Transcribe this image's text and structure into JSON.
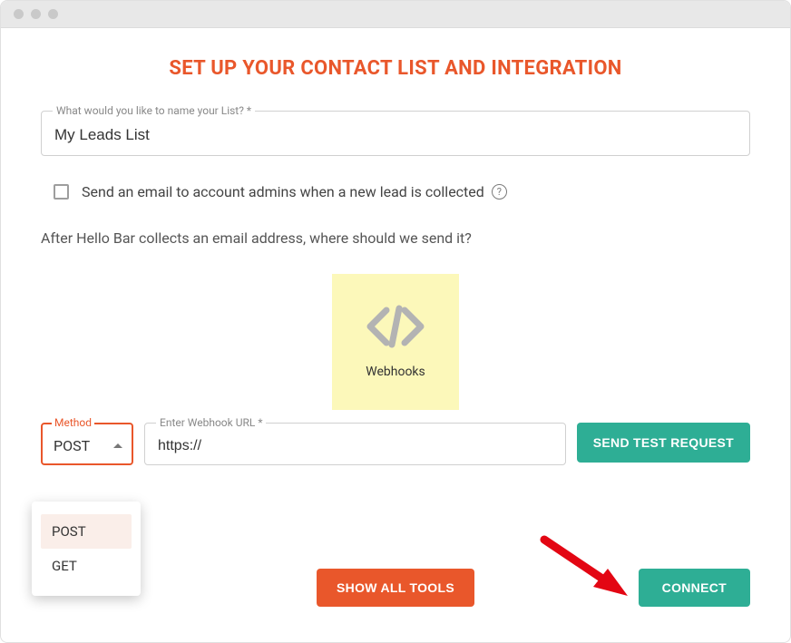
{
  "header": {
    "title": "SET UP YOUR CONTACT LIST AND INTEGRATION"
  },
  "list_name": {
    "label": "What would you like to name your List? *",
    "value": "My Leads List"
  },
  "admin_email": {
    "label": "Send an email to account admins when a new lead is collected",
    "checked": false
  },
  "prompt": "After Hello Bar collects an email address, where should we send it?",
  "integration_tile": {
    "label": "Webhooks"
  },
  "method": {
    "label": "Method",
    "value": "POST",
    "options": [
      "POST",
      "GET"
    ]
  },
  "webhook_url": {
    "label": "Enter Webhook URL *",
    "value": "https://"
  },
  "buttons": {
    "send_test": "SEND TEST REQUEST",
    "show_all": "SHOW ALL TOOLS",
    "connect": "CONNECT"
  }
}
